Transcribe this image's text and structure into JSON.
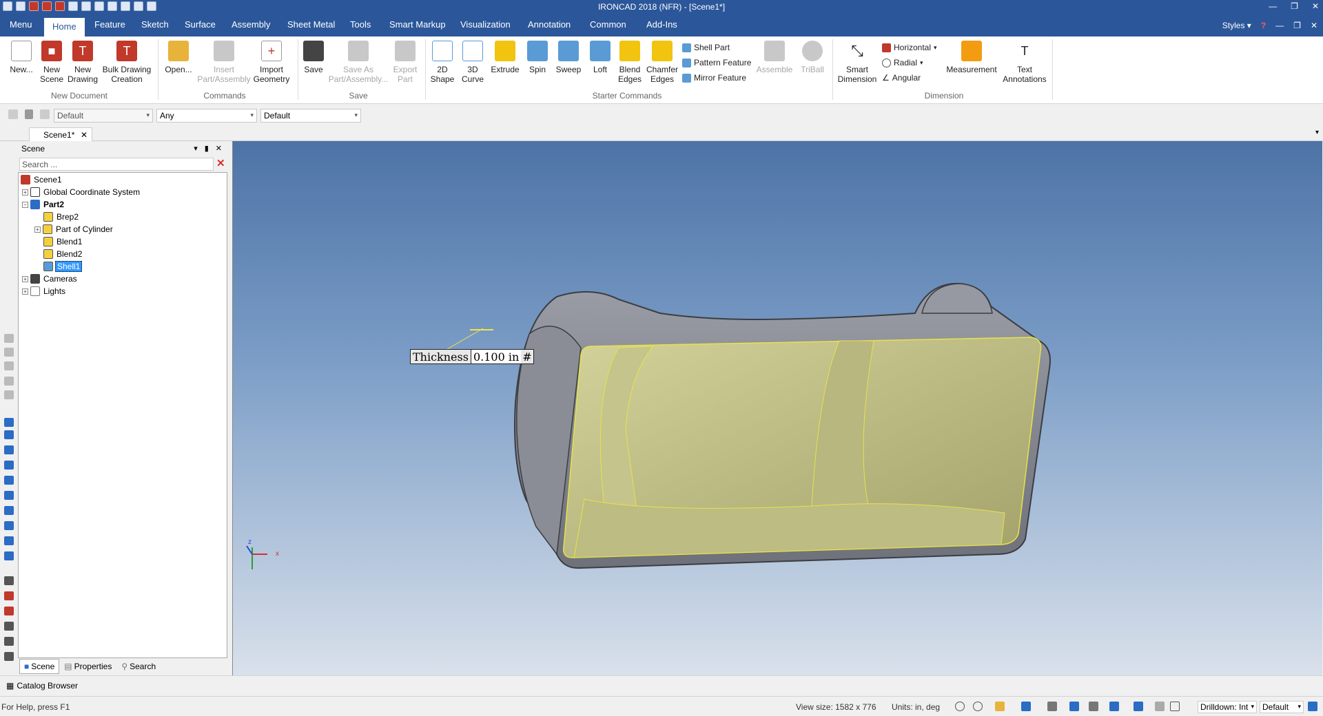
{
  "window": {
    "title": "IRONCAD 2018 (NFR) - [Scene1*]"
  },
  "menu": {
    "tabs": [
      "Menu",
      "Home",
      "Feature",
      "Sketch",
      "Surface",
      "Assembly",
      "Sheet Metal",
      "Tools",
      "Smart Markup",
      "Visualization",
      "Annotation",
      "Common",
      "Add-Ins"
    ],
    "active_tab": "Home",
    "styles_label": "Styles"
  },
  "ribbon": {
    "new_document": {
      "new": "New...",
      "new_scene": "New\nScene",
      "new_drawing": "New\nDrawing",
      "bulk": "Bulk Drawing\nCreation",
      "group": "New Document"
    },
    "commands": {
      "open": "Open...",
      "insert": "Insert\nPart/Assembly",
      "import": "Import\nGeometry",
      "group": "Commands"
    },
    "save": {
      "save": "Save",
      "save_as": "Save As\nPart/Assembly...",
      "export": "Export\nPart",
      "group": "Save"
    },
    "starter": {
      "shape2d": "2D\nShape",
      "curve3d": "3D\nCurve",
      "extrude": "Extrude",
      "spin": "Spin",
      "sweep": "Sweep",
      "loft": "Loft",
      "blend": "Blend\nEdges",
      "chamfer": "Chamfer\nEdges",
      "shell_part": "Shell Part",
      "pattern_feature": "Pattern Feature",
      "mirror_feature": "Mirror Feature",
      "assemble": "Assemble",
      "triball": "TriBall",
      "group": "Starter Commands"
    },
    "dimension": {
      "smart": "Smart\nDimension",
      "horizontal": "Horizontal",
      "radial": "Radial",
      "angular": "Angular",
      "measurement": "Measurement",
      "text_annotations": "Text\nAnnotations",
      "group": "Dimension"
    }
  },
  "propbar": {
    "combo1": "Default",
    "combo2": "Any",
    "combo3": "Default"
  },
  "doc_tab": "Scene1*",
  "scene_panel": {
    "title": "Scene",
    "search_placeholder": "Search ...",
    "tree": [
      {
        "label": "Scene1"
      },
      {
        "label": "Global Coordinate System"
      },
      {
        "label": "Part2"
      },
      {
        "label": "Brep2"
      },
      {
        "label": "Part of Cylinder"
      },
      {
        "label": "Blend1"
      },
      {
        "label": "Blend2"
      },
      {
        "label": "Shell1"
      },
      {
        "label": "Cameras"
      },
      {
        "label": "Lights"
      }
    ],
    "bottom_tabs": [
      "Scene",
      "Properties",
      "Search"
    ]
  },
  "viewport": {
    "thickness_label": "Thickness",
    "thickness_value": "0.100 in",
    "thickness_suffix": "#",
    "axis_x": "x",
    "axis_z": "z",
    "colors": {
      "body": "#8a8d96",
      "face": "#bdbc82",
      "edge": "#e8e24a"
    }
  },
  "catalog_browser": "Catalog Browser",
  "status": {
    "help": "For Help, press F1",
    "view_size": "View size: 1582 x  776",
    "units": "Units: in, deg",
    "drilldown": "Drilldown: Int",
    "default": "Default"
  }
}
